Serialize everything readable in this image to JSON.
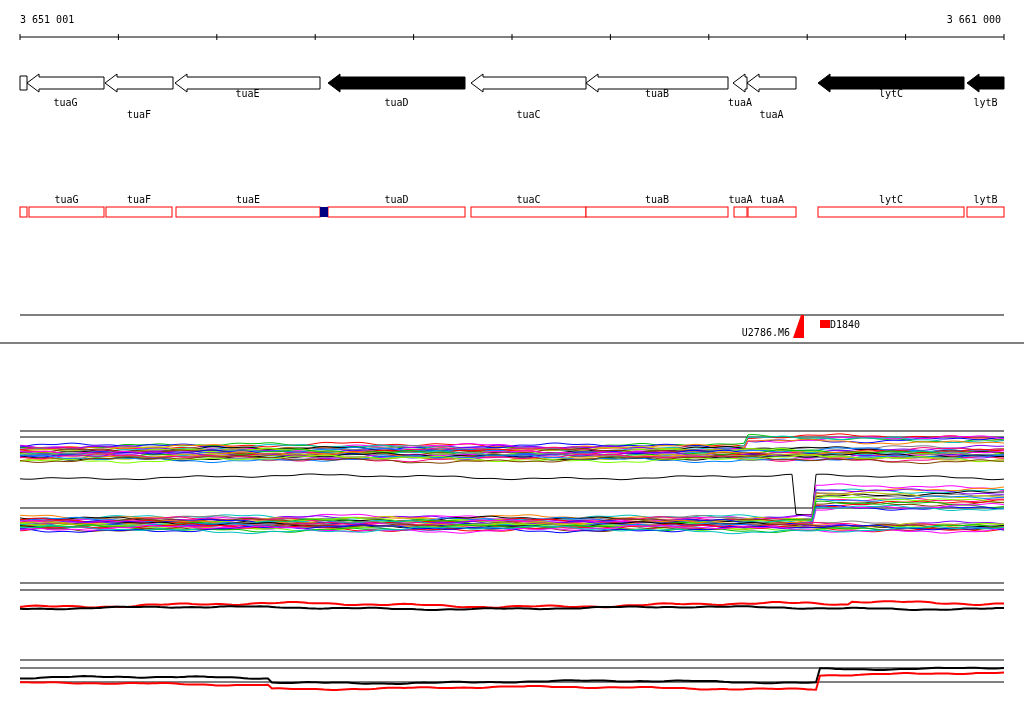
{
  "ruler": {
    "start_label": "3 651 001",
    "end_label": "3 661 000"
  },
  "genes": [
    {
      "filled": false
    },
    {
      "label": "tuaG",
      "filled": false
    },
    {
      "label": "tuaF",
      "filled": false
    },
    {
      "label": "tuaE",
      "filled": false
    },
    {
      "label": "tuaD",
      "filled": true
    },
    {
      "label": "tuaC",
      "filled": false
    },
    {
      "label": "tuaB",
      "filled": false
    },
    {
      "label": "tuaA",
      "filled": false
    },
    {
      "label": "tuaA",
      "filled": false
    },
    {
      "label": "lytC",
      "filled": true
    },
    {
      "label": "lytB",
      "filled": true
    }
  ],
  "features": [
    {
      "kind": "box"
    },
    {
      "kind": "box",
      "label": "tuaG"
    },
    {
      "kind": "box",
      "label": "tuaF"
    },
    {
      "kind": "box",
      "label": "tuaE"
    },
    {
      "kind": "box",
      "label": "tuaD"
    },
    {
      "kind": "box",
      "label": "tuaC"
    },
    {
      "kind": "box",
      "label": "tuaB"
    },
    {
      "kind": "box",
      "label": "tuaA"
    },
    {
      "kind": "box",
      "label": "tuaA"
    },
    {
      "kind": "box",
      "label": "lytC"
    },
    {
      "kind": "box",
      "label": "lytB"
    }
  ],
  "markers": [
    {
      "label": "U2786.M6"
    },
    {
      "label": "D1840"
    }
  ]
}
